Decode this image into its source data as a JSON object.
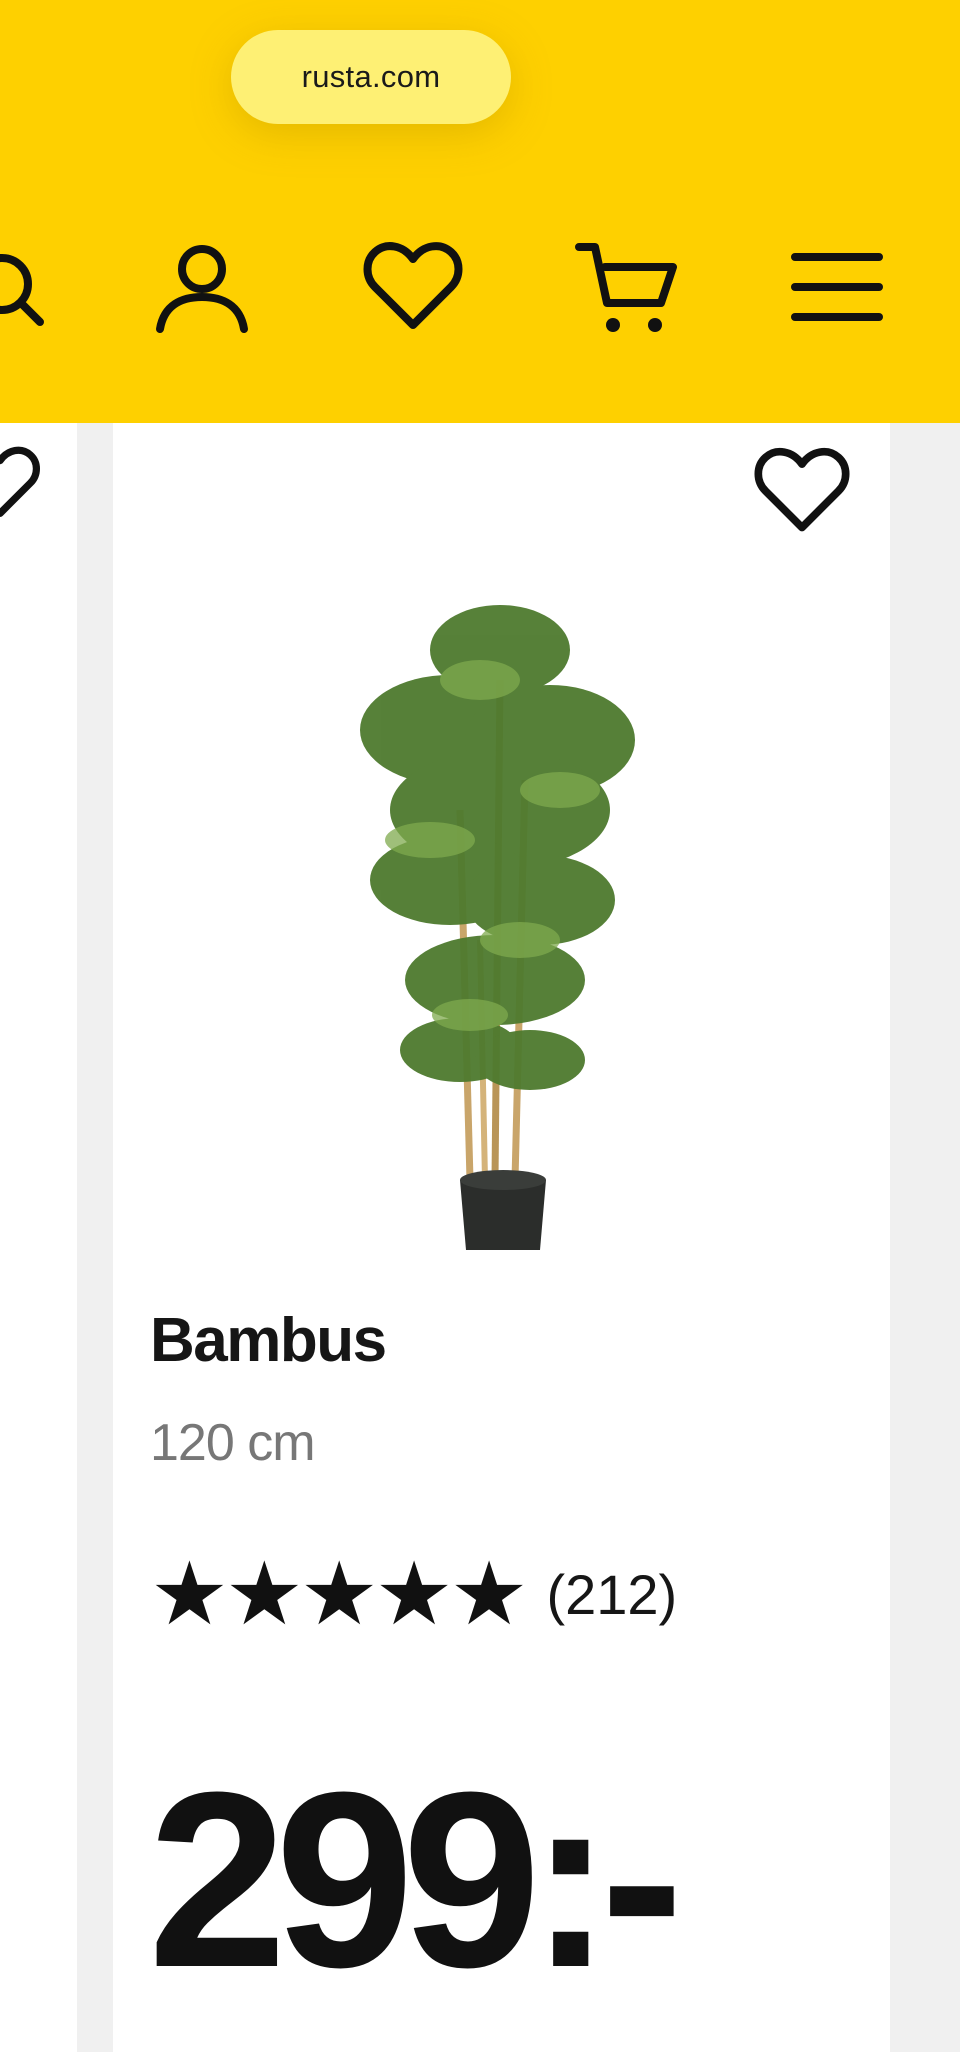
{
  "browser": {
    "url": "rusta.com"
  },
  "header": {
    "icons": [
      "search-icon",
      "user-icon",
      "heart-icon",
      "cart-icon",
      "menu-icon"
    ],
    "background": "#fed000"
  },
  "product": {
    "name": "Bambus",
    "size": "120 cm",
    "rating": {
      "stars": 5,
      "count": "(212)"
    },
    "price": "299:-"
  }
}
